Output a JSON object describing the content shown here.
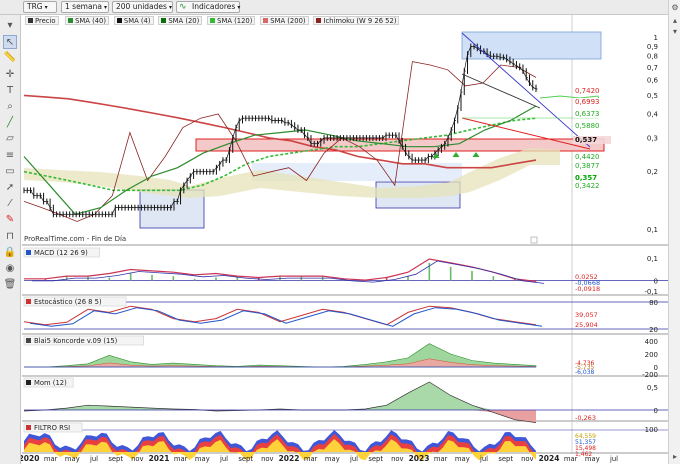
{
  "toolbar": {
    "symbol": "TRG",
    "period": "1 semana",
    "units": "200 unidades",
    "indicators": "Indicadores"
  },
  "icons": {
    "left_tools": [
      "dropdown-arrow-icon",
      "cursor-icon",
      "ruler-icon",
      "crosshair-icon",
      "text-icon",
      "zoom-icon",
      "trendline-icon",
      "channel-icon",
      "fibonacci-icon",
      "rectangle-icon",
      "arrow-icon",
      "segment-icon",
      "brush-icon",
      "magnet-icon",
      "lock-icon",
      "eye-icon",
      "trash-icon"
    ],
    "right_tools": [
      "settings-icon",
      "arrow-up-icon",
      "arrow-down-icon",
      "scroll-icon"
    ]
  },
  "colors": {
    "price": "#111111",
    "sma40": "#2e8b2e",
    "sma4": "#111111",
    "sma20": "#0a6e0a",
    "sma120": "#33bb33",
    "sma200": "#cc4444",
    "ichimoku": "#8b2323",
    "trend_red": "#e02020",
    "trend_blue": "#3a3acc",
    "zone_blue": "#cfe0f7",
    "zone_red": "#f3c9c9",
    "macd": "#cc3355",
    "macd_signal": "#3333aa",
    "hist_up": "#66bb66",
    "hist_down": "#dd4444",
    "sto_k": "#cc3333",
    "sto_d": "#2255cc"
  },
  "chart_data": [
    {
      "type": "line",
      "title": "TRG",
      "subtitle": "ProRealTime.com - Fin de Día",
      "legend": [
        "Precio",
        "SMA (40)",
        "SMA (4)",
        "SMA (20)",
        "SMA (120)",
        "SMA (200)",
        "Ichimoku (W 9 26 52)"
      ],
      "y_scale": "log",
      "yticks": [
        "1",
        "0,9",
        "0,8",
        "0,7",
        "0,6",
        "0,5",
        "0,4",
        "0,3",
        "0,2",
        "0,1"
      ],
      "price_labels": [
        "0,7420",
        "0,6993",
        "0,6373",
        "0,5880",
        "0,537",
        "0,4420",
        "0,3877",
        "0,357",
        "0,3422"
      ],
      "xticks": [
        "2020",
        "mar",
        "may",
        "jul",
        "sept",
        "nov",
        "2021",
        "mar",
        "may",
        "jul",
        "sept",
        "nov",
        "2022",
        "mar",
        "may",
        "jul",
        "sept",
        "nov",
        "2023",
        "mar",
        "may",
        "jul",
        "sept",
        "nov",
        "2024",
        "mar",
        "may",
        "jul"
      ],
      "series": [
        {
          "name": "Precio",
          "x_start": "2020-01",
          "step": "1 semana",
          "values": [
            0.16,
            0.16,
            0.16,
            0.15,
            0.15,
            0.15,
            0.14,
            0.14,
            0.13,
            0.12,
            0.12,
            0.12,
            0.12,
            0.12,
            0.12,
            0.12,
            0.12,
            0.12,
            0.12,
            0.12,
            0.12,
            0.12,
            0.12,
            0.12,
            0.12,
            0.12,
            0.12,
            0.12,
            0.13,
            0.13,
            0.13,
            0.13,
            0.13,
            0.13,
            0.13,
            0.13,
            0.13,
            0.13,
            0.13,
            0.13,
            0.13,
            0.13,
            0.13,
            0.13,
            0.13,
            0.13,
            0.14,
            0.14,
            0.16,
            0.17,
            0.18,
            0.19,
            0.2,
            0.2,
            0.2,
            0.2,
            0.2,
            0.2,
            0.2,
            0.21,
            0.22,
            0.23,
            0.23,
            0.26,
            0.3,
            0.34,
            0.37,
            0.38,
            0.38,
            0.38,
            0.38,
            0.38,
            0.38,
            0.38,
            0.38,
            0.38,
            0.37,
            0.37,
            0.37,
            0.37,
            0.36,
            0.36,
            0.35,
            0.34,
            0.33,
            0.33,
            0.31,
            0.3,
            0.28,
            0.28,
            0.28,
            0.29,
            0.3,
            0.3,
            0.3,
            0.3,
            0.3,
            0.3,
            0.3,
            0.3,
            0.3,
            0.3,
            0.3,
            0.3,
            0.3,
            0.3,
            0.3,
            0.3,
            0.3,
            0.3,
            0.3,
            0.31,
            0.31,
            0.31,
            0.31,
            0.29,
            0.27,
            0.25,
            0.24,
            0.23,
            0.23,
            0.23,
            0.23,
            0.23,
            0.24,
            0.24,
            0.25,
            0.26,
            0.27,
            0.28,
            0.3,
            0.33,
            0.37,
            0.43,
            0.52,
            0.67,
            0.82,
            0.9,
            0.9,
            0.88,
            0.85,
            0.85,
            0.82,
            0.8,
            0.8,
            0.8,
            0.79,
            0.79,
            0.77,
            0.75,
            0.73,
            0.71,
            0.7,
            0.67,
            0.62,
            0.58,
            0.55,
            0.54
          ]
        },
        {
          "name": "SMA (40)",
          "values": [
            0.24,
            0.17,
            0.12,
            0.13,
            0.16,
            0.19,
            0.21,
            0.25,
            0.28,
            0.31,
            0.32,
            0.33,
            0.31,
            0.29,
            0.28,
            0.27,
            0.27,
            0.28,
            0.33,
            0.37,
            0.44
          ]
        },
        {
          "name": "SMA (120)",
          "values": [
            0.2,
            0.19,
            0.18,
            0.17,
            0.16,
            0.16,
            0.16,
            0.16,
            0.17,
            0.19,
            0.22,
            0.24,
            0.25,
            0.26,
            0.27,
            0.27,
            0.28,
            0.29,
            0.3,
            0.31,
            0.33,
            0.35,
            0.37,
            0.38
          ]
        },
        {
          "name": "SMA (200)",
          "values": [
            0.5,
            0.49,
            0.48,
            0.46,
            0.44,
            0.42,
            0.4,
            0.38,
            0.36,
            0.34,
            0.32,
            0.3,
            0.29,
            0.27,
            0.26,
            0.24,
            0.23,
            0.22,
            0.22,
            0.21,
            0.21,
            0.21,
            0.22,
            0.23
          ]
        },
        {
          "name": "Ichimoku (W 9 26 52)",
          "values": [
            0.14,
            0.13,
            0.12,
            0.11,
            0.12,
            0.15,
            0.32,
            0.18,
            0.24,
            0.34,
            0.38,
            0.4,
            0.29,
            0.19,
            0.2,
            0.21,
            0.18,
            0.25,
            0.3,
            0.27,
            0.23,
            0.17,
            0.75,
            0.72,
            0.68,
            0.56,
            0.58,
            0.72,
            0.7,
            0.62
          ]
        }
      ]
    },
    {
      "type": "line",
      "title": "MACD (12 26 9)",
      "yticks": [
        "0,1",
        "0",
        "-0,1"
      ],
      "values": [
        -0.02,
        -0.02,
        0.0,
        0.0,
        0.02,
        0.05,
        0.04,
        0.03,
        0.01,
        0.02,
        0.0,
        -0.01,
        0.0,
        0.0,
        0.0,
        -0.02,
        -0.03,
        -0.01,
        0.03,
        0.13,
        0.1,
        0.07,
        0.03,
        -0.02,
        -0.04
      ],
      "labels": [
        "0,0252",
        "-0,0668",
        "-0,0918"
      ]
    },
    {
      "type": "line",
      "title": "Estocástico (26 8 5)",
      "yticks": [
        "80",
        "20"
      ],
      "values": [
        30,
        20,
        28,
        70,
        60,
        80,
        70,
        40,
        30,
        40,
        70,
        60,
        30,
        50,
        70,
        60,
        40,
        20,
        60,
        80,
        75,
        60,
        40,
        30,
        20
      ],
      "labels": [
        "39,057",
        "25,904"
      ]
    },
    {
      "type": "area",
      "title": "Blai5 Koncorde v.09 (15)",
      "yticks": [
        "400",
        "200",
        "0",
        "-200"
      ],
      "values": [
        0,
        0,
        20,
        50,
        180,
        80,
        40,
        60,
        40,
        20,
        10,
        30,
        20,
        10,
        0,
        10,
        40,
        80,
        140,
        360,
        200,
        100,
        60,
        40,
        20
      ],
      "labels": [
        "-4,736",
        "-5,735",
        "-6,038"
      ]
    },
    {
      "type": "area",
      "title": "Mom (12)",
      "yticks": [
        "0,5",
        "0"
      ],
      "values": [
        -0.02,
        0.0,
        0.04,
        0.1,
        0.08,
        0.06,
        0.04,
        0.02,
        0.01,
        -0.02,
        -0.01,
        0.0,
        0.02,
        0.0,
        0.0,
        0.0,
        0.02,
        0.1,
        0.35,
        0.58,
        0.3,
        0.1,
        -0.05,
        -0.2,
        -0.26
      ],
      "labels": [
        "-0,263"
      ]
    },
    {
      "type": "line",
      "title": "FILTRO RSI",
      "yticks": [
        "100"
      ],
      "labels": [
        "64,559",
        "51,357",
        "15,498",
        "1,462"
      ]
    }
  ]
}
